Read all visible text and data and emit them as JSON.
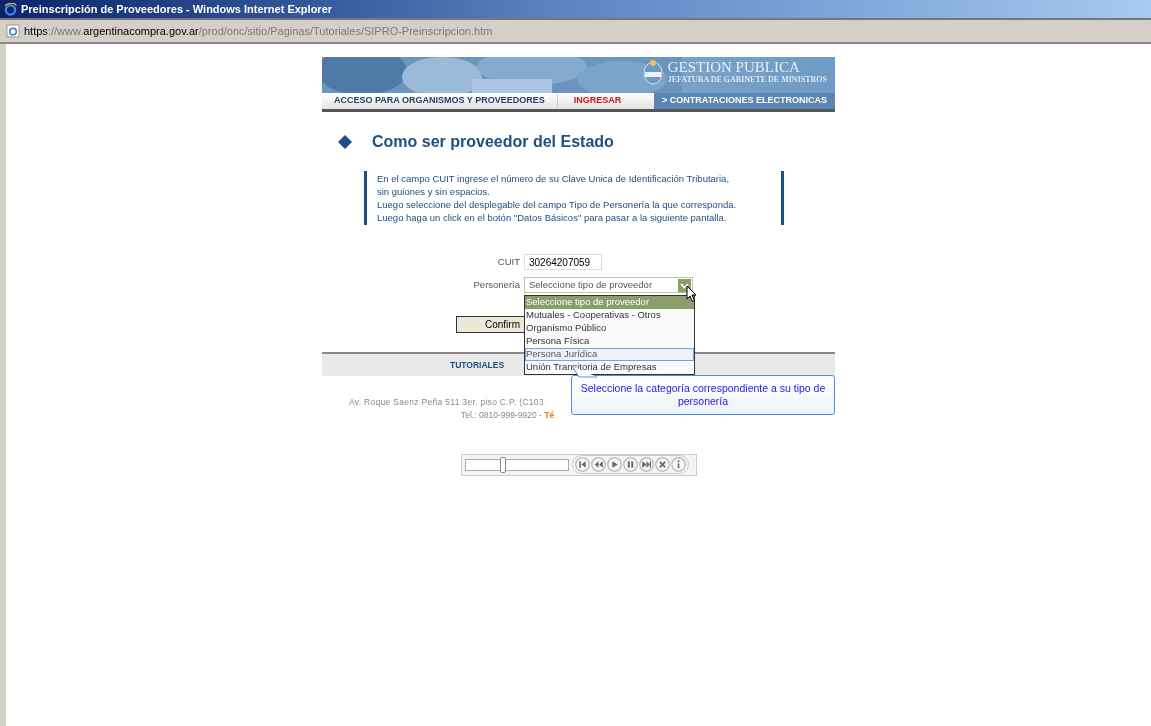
{
  "window": {
    "title": "Preinscripción de Proveedores - Windows Internet Explorer"
  },
  "address_bar": {
    "scheme": "https",
    "separator": "://www.",
    "domain": "argentinacompra.gov.ar",
    "path": "/prod/onc/sitio/Paginas/Tutoriales/SIPRO-Preinscripcion.htm"
  },
  "banner": {
    "brand": "GESTION PUBLICA",
    "subtitle": "JEFATURA DE GABINETE DE MINISTROS"
  },
  "nav": [
    {
      "label": "ACCESO PARA ORGANISMOS Y PROVEEDORES",
      "kind": "plain"
    },
    {
      "label": "INGRESAR",
      "kind": "highlight"
    },
    {
      "label": "> CONTRATACIONES ELECTRONICAS",
      "kind": "tab"
    }
  ],
  "heading": "Como ser proveedor del Estado",
  "instructions": [
    "En el campo CUIT ingrese el número de su Clave Unica de Identificación Tributaria,",
    "sin guiones y sin espacios.",
    "Luego seleccione del desplegable del campo Tipo de Personería la que corresponda.",
    "Luego haga un click en el botón \"Datos Básicos\" para pasar a la siguiente pantalla."
  ],
  "form": {
    "cuit_label": "CUIT",
    "cuit_value": "30264207059",
    "personeria_label": "Personería",
    "personeria_value": "Seleccione tipo de proveedor",
    "options": [
      {
        "label": "Seleccione tipo de proveedor",
        "selected": true,
        "hovered": false
      },
      {
        "label": "Mutuales - Cooperativas - Otros",
        "selected": false,
        "hovered": false
      },
      {
        "label": "Organismo Público",
        "selected": false,
        "hovered": false
      },
      {
        "label": "Persona Física",
        "selected": false,
        "hovered": false
      },
      {
        "label": "Persona Jurídica",
        "selected": false,
        "hovered": true
      },
      {
        "label": "Unión Transitoria de Empresas",
        "selected": false,
        "hovered": false
      }
    ],
    "confirm_button": "Confirm"
  },
  "footer_nav": [
    {
      "label": "TUTORIALES"
    }
  ],
  "footer_address": [
    "Av. Roque Saenz Peña 511  3er. piso  C.P. (C103",
    "Tel.: 0810-999-9920 -"
  ],
  "footer_link": "Té",
  "tooltip": "Seleccione la categoría correspondiente a su tipo de personería",
  "player": {
    "level": 0.35
  }
}
